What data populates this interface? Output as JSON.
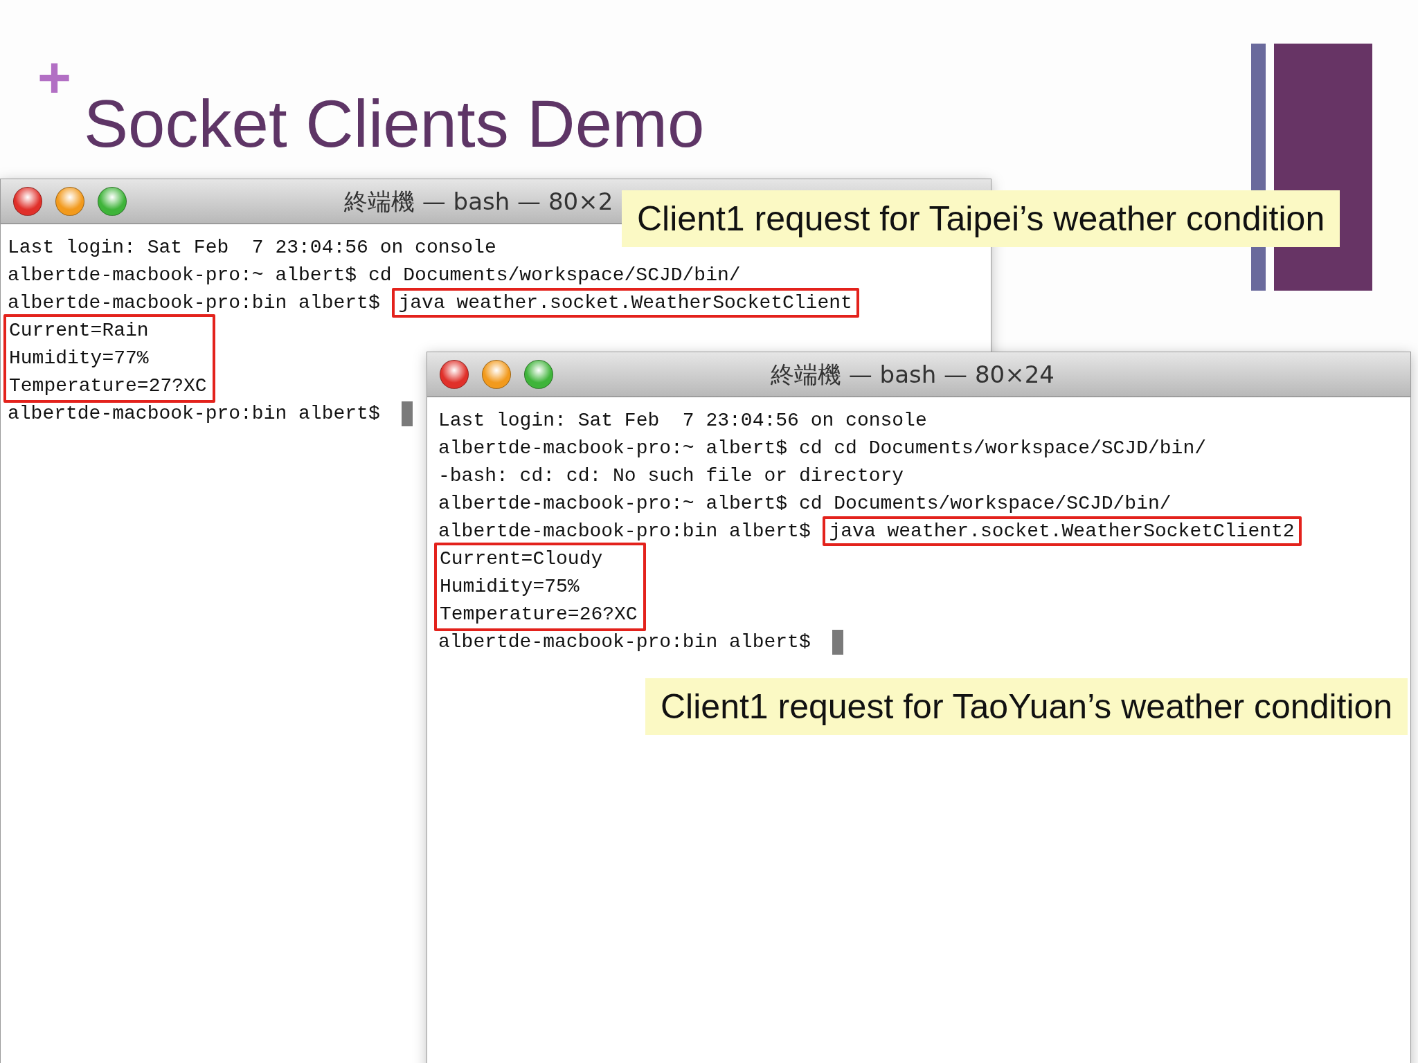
{
  "slide": {
    "marker": "+",
    "title": "Socket Clients Demo"
  },
  "terminals": [
    {
      "title": "終端機 — bash — 80×2",
      "lines": [
        {
          "kind": "text",
          "text": "Last login: Sat Feb  7 23:04:56 on console"
        },
        {
          "kind": "text",
          "text": "albertde-macbook-pro:~ albert$ cd Documents/workspace/SCJD/bin/"
        },
        {
          "kind": "command",
          "prompt": "albertde-macbook-pro:bin albert$",
          "command": "java weather.socket.WeatherSocketClient",
          "highlight": true
        },
        {
          "kind": "output",
          "highlight": true,
          "lines": [
            "Current=Rain",
            "Humidity=77%",
            "Temperature=27?XC"
          ]
        },
        {
          "kind": "command",
          "prompt": "albertde-macbook-pro:bin albert$",
          "cursor": true
        }
      ]
    },
    {
      "title": "終端機 — bash — 80×24",
      "lines": [
        {
          "kind": "text",
          "text": "Last login: Sat Feb  7 23:04:56 on console"
        },
        {
          "kind": "text",
          "text": "albertde-macbook-pro:~ albert$ cd cd Documents/workspace/SCJD/bin/"
        },
        {
          "kind": "text",
          "text": "-bash: cd: cd: No such file or directory"
        },
        {
          "kind": "text",
          "text": "albertde-macbook-pro:~ albert$ cd Documents/workspace/SCJD/bin/"
        },
        {
          "kind": "command",
          "prompt": "albertde-macbook-pro:bin albert$",
          "command": "java weather.socket.WeatherSocketClient2",
          "highlight": true
        },
        {
          "kind": "output",
          "highlight": true,
          "lines": [
            "Current=Cloudy",
            "Humidity=75%",
            "Temperature=26?XC"
          ]
        },
        {
          "kind": "command",
          "prompt": "albertde-macbook-pro:bin albert$",
          "cursor": true
        }
      ]
    }
  ],
  "callouts": [
    "Client1 request for Taipei’s weather condition",
    "Client1 request for TaoYuan’s weather condition"
  ]
}
